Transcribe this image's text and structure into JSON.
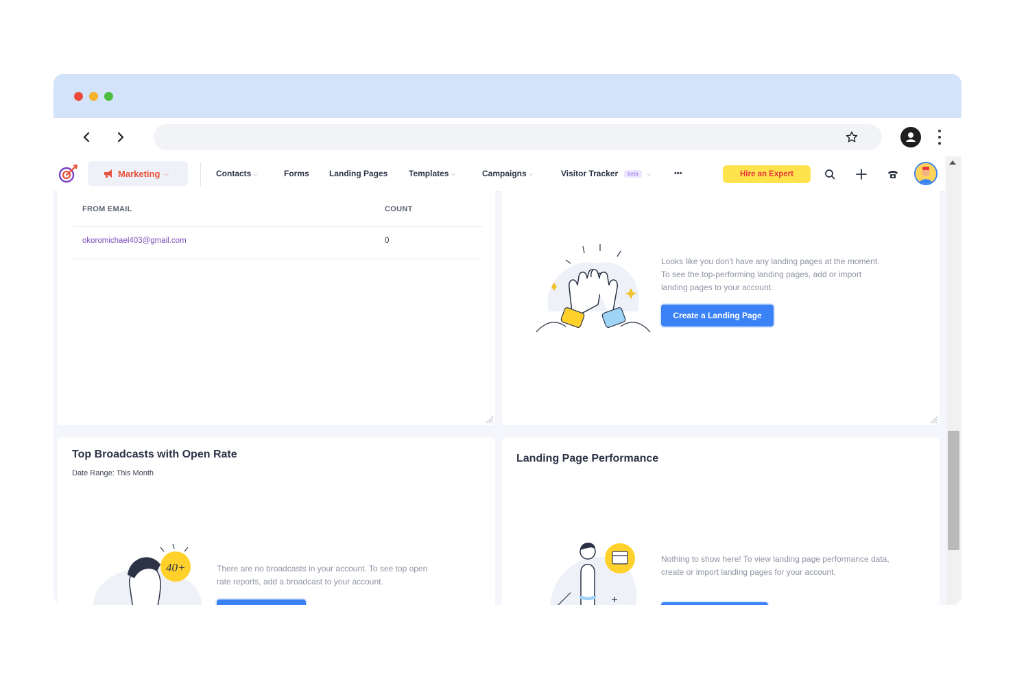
{
  "browser": {
    "traffic_lights": [
      "#ee4a3c",
      "#f5b22a",
      "#4bbe3e"
    ]
  },
  "nav": {
    "marketing_label": "Marketing",
    "items": [
      "Contacts",
      "Forms",
      "Landing Pages",
      "Templates",
      "Campaigns",
      "Visitor Tracker"
    ],
    "beta_badge": "beta",
    "more": "•••",
    "hire_label": "Hire an Expert"
  },
  "email_table": {
    "headers": {
      "from_email": "FROM EMAIL",
      "count": "COUNT"
    },
    "rows": [
      {
        "email": "okoromichael403@gmail.com",
        "count": "0"
      }
    ]
  },
  "landing_empty": {
    "message": "Looks like you don't have any landing pages at the moment. To see the top-performing landing pages, add or import landing pages to your account.",
    "button": "Create a Landing Page"
  },
  "broadcasts": {
    "title": "Top Broadcasts with Open Rate",
    "subtitle": "Date Range: This Month",
    "badge": "40+",
    "message": "There are no broadcasts in your account. To see top open rate reports, add a broadcast to your account."
  },
  "landing_perf": {
    "title": "Landing Page Performance",
    "message": "Nothing to show here! To view landing page performance data, create or import landing pages for your account."
  },
  "colors": {
    "accent": "#3b82f6",
    "marketing": "#e8513b",
    "hire_bg": "#ffe34d",
    "link": "#7a4bb8"
  }
}
